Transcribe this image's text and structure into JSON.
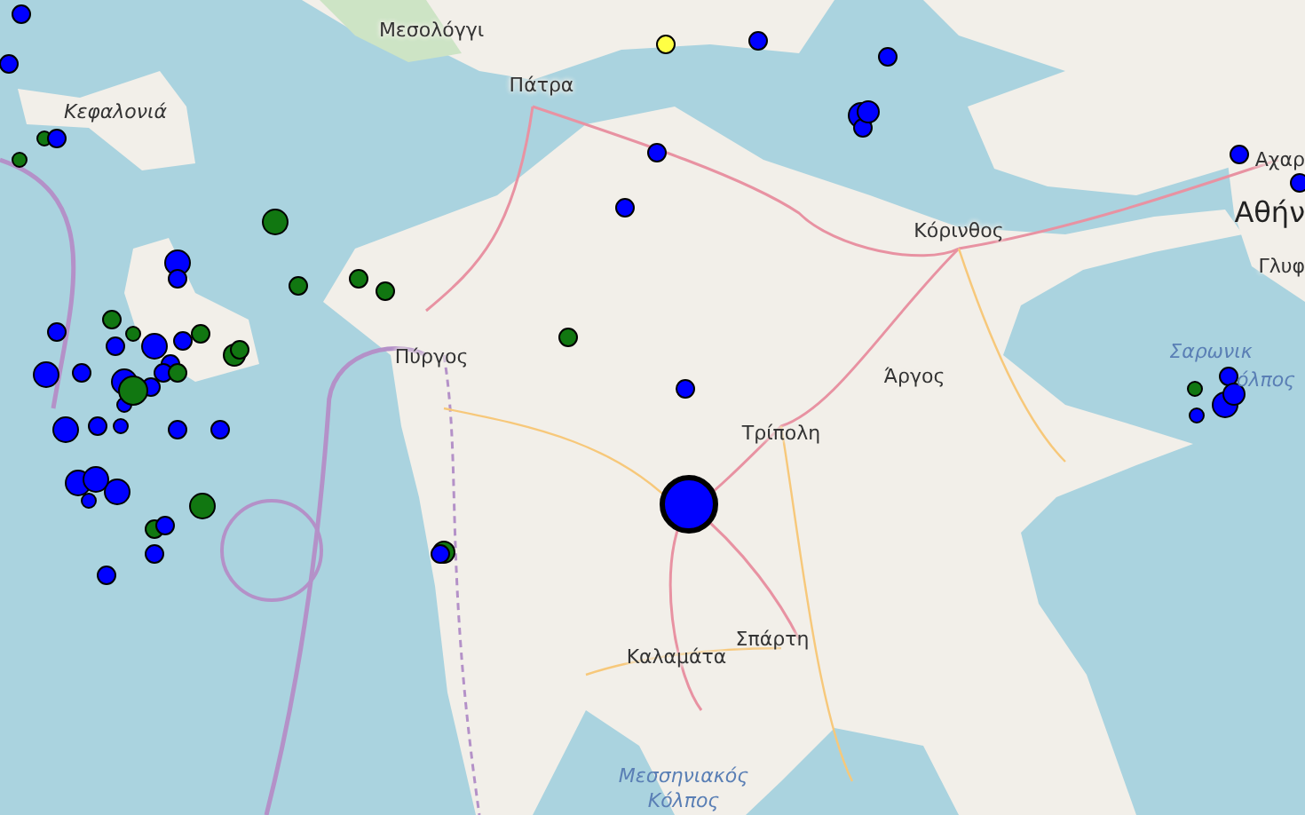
{
  "map": {
    "labels": [
      {
        "text": "Μεσολόγγι",
        "kind": "town"
      },
      {
        "text": "Πάτρα",
        "kind": "town"
      },
      {
        "text": "Κεφαλονιά",
        "kind": "island"
      },
      {
        "text": "Κόρινθος",
        "kind": "town"
      },
      {
        "text": "Αχαρ",
        "kind": "town"
      },
      {
        "text": "Αθήν",
        "kind": "city"
      },
      {
        "text": "Γλυφ",
        "kind": "town"
      },
      {
        "text": "Πύργος",
        "kind": "town"
      },
      {
        "text": "Άργος",
        "kind": "town"
      },
      {
        "text": "Τρίπολη",
        "kind": "town"
      },
      {
        "text": "Σαρωνικ",
        "kind": "sea"
      },
      {
        "text": "όλπος",
        "kind": "sea"
      },
      {
        "text": "Σπάρτη",
        "kind": "town"
      },
      {
        "text": "Καλαμάτα",
        "kind": "town"
      },
      {
        "text": "Μεσσηνιακός",
        "kind": "sea"
      },
      {
        "text": "Κόλπος",
        "kind": "sea"
      }
    ],
    "earthquakes": [
      {
        "color": "#0000ff"
      },
      {
        "color": "#0000ff"
      },
      {
        "color": "#117711"
      },
      {
        "color": "#0000ff"
      },
      {
        "color": "#117711"
      },
      {
        "color": "#117711"
      },
      {
        "color": "#0000ff"
      },
      {
        "color": "#0000ff"
      },
      {
        "color": "#117711"
      },
      {
        "color": "#117711"
      },
      {
        "color": "#117711"
      },
      {
        "color": "#117711"
      },
      {
        "color": "#0000ff"
      },
      {
        "color": "#0000ff"
      },
      {
        "color": "#0000ff"
      },
      {
        "color": "#ffff44"
      },
      {
        "color": "#0000ff"
      },
      {
        "color": "#0000ff"
      },
      {
        "color": "#0000ff"
      },
      {
        "color": "#0000ff"
      },
      {
        "color": "#0000ff"
      },
      {
        "color": "#0000ff"
      },
      {
        "color": "#0000ff"
      },
      {
        "color": "#117711"
      },
      {
        "color": "#0000ff"
      },
      {
        "color": "#0000ff"
      },
      {
        "color": "#0000ff"
      },
      {
        "color": "#0000ff"
      },
      {
        "color": "#117711"
      },
      {
        "color": "#0000ff"
      },
      {
        "color": "#0000ff"
      },
      {
        "color": "#0000ff"
      },
      {
        "color": "#0000ff"
      },
      {
        "color": "#117711"
      },
      {
        "color": "#117711"
      },
      {
        "color": "#0000ff"
      },
      {
        "color": "#0000ff"
      },
      {
        "color": "#0000ff"
      },
      {
        "color": "#117711"
      },
      {
        "color": "#0000ff"
      },
      {
        "color": "#0000ff"
      },
      {
        "color": "#0000ff"
      },
      {
        "color": "#0000ff"
      },
      {
        "color": "#117711"
      },
      {
        "color": "#0000ff"
      },
      {
        "color": "#0000ff"
      },
      {
        "color": "#0000ff"
      },
      {
        "color": "#0000ff"
      },
      {
        "color": "#0000ff"
      },
      {
        "color": "#0000ff"
      },
      {
        "color": "#0000ff"
      },
      {
        "color": "#117711"
      },
      {
        "color": "#0000ff"
      },
      {
        "color": "#117711"
      },
      {
        "color": "#0000ff"
      },
      {
        "color": "#0000ff"
      },
      {
        "color": "#0000ff"
      },
      {
        "color": "#0000ff"
      },
      {
        "color": "#0000ff"
      },
      {
        "color": "#117711"
      },
      {
        "color": "#117711"
      },
      {
        "color": "#117711"
      },
      {
        "color": "#0000ff"
      }
    ]
  }
}
